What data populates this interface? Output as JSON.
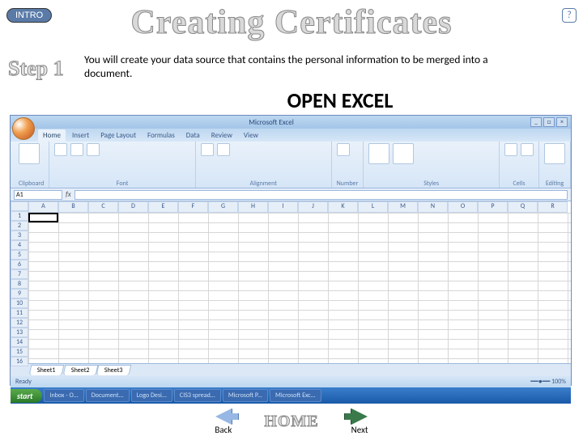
{
  "buttons": {
    "intro": "INTRO",
    "help": "?",
    "back": "Back",
    "next": "Next",
    "home": "HOME"
  },
  "title": "Creating Certificates",
  "step_label": "Step 1",
  "description": "You will create your data source that contains the personal information to be merged into a document.",
  "action": "OPEN EXCEL",
  "excel": {
    "app_title": "Microsoft Excel",
    "tabs": [
      "Home",
      "Insert",
      "Page Layout",
      "Formulas",
      "Data",
      "Review",
      "View"
    ],
    "groups": [
      "Clipboard",
      "Font",
      "Alignment",
      "Number",
      "Styles",
      "Cells",
      "Editing"
    ],
    "namebox": "A1",
    "fx": "fx",
    "cols": [
      "A",
      "B",
      "C",
      "D",
      "E",
      "F",
      "G",
      "H",
      "I",
      "J",
      "K",
      "L",
      "M",
      "N",
      "O",
      "P",
      "Q",
      "R"
    ],
    "rows": [
      "1",
      "2",
      "3",
      "4",
      "5",
      "6",
      "7",
      "8",
      "9",
      "10",
      "11",
      "12",
      "13",
      "14",
      "15",
      "16"
    ],
    "sheets": [
      "Sheet1",
      "Sheet2",
      "Sheet3"
    ],
    "status": "Ready",
    "start": "start",
    "taskbar": [
      "Inbox - O...",
      "Document...",
      "Logo Desi...",
      "CIS3 spread...",
      "Microsoft P...",
      "Microsoft Exc..."
    ]
  }
}
